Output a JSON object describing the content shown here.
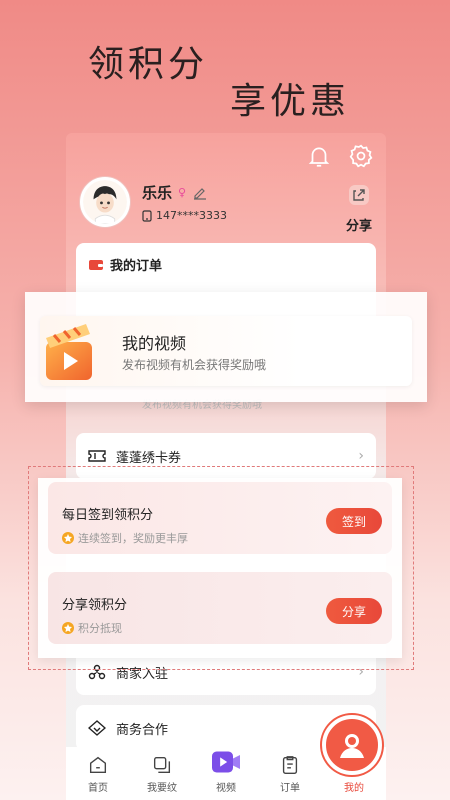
{
  "hero": {
    "line1": "领积分",
    "line2": "享优惠"
  },
  "profile": {
    "name": "乐乐",
    "phone": "147****3333",
    "share_label": "分享"
  },
  "orders": {
    "title": "我的订单"
  },
  "video_card": {
    "title": "我的视频",
    "subtitle": "发布视频有机会获得奖励哦",
    "ghost_subtitle": "发布视频有机会获得奖励哦"
  },
  "voucher": {
    "label": "蓬蓬绣卡券"
  },
  "points": [
    {
      "title": "每日签到领积分",
      "subtitle": "连续签到，奖励更丰厚",
      "button": "签到"
    },
    {
      "title": "分享领积分",
      "subtitle": "积分抵现",
      "button": "分享"
    }
  ],
  "menu": {
    "merchant": "商家入驻",
    "business": "商务合作"
  },
  "tabs": [
    {
      "label": "首页"
    },
    {
      "label": "我要纹"
    },
    {
      "label": "视频"
    },
    {
      "label": "订单"
    },
    {
      "label": "我的"
    }
  ],
  "colors": {
    "accent": "#e8483a",
    "hero_bg": "#f08a86"
  }
}
